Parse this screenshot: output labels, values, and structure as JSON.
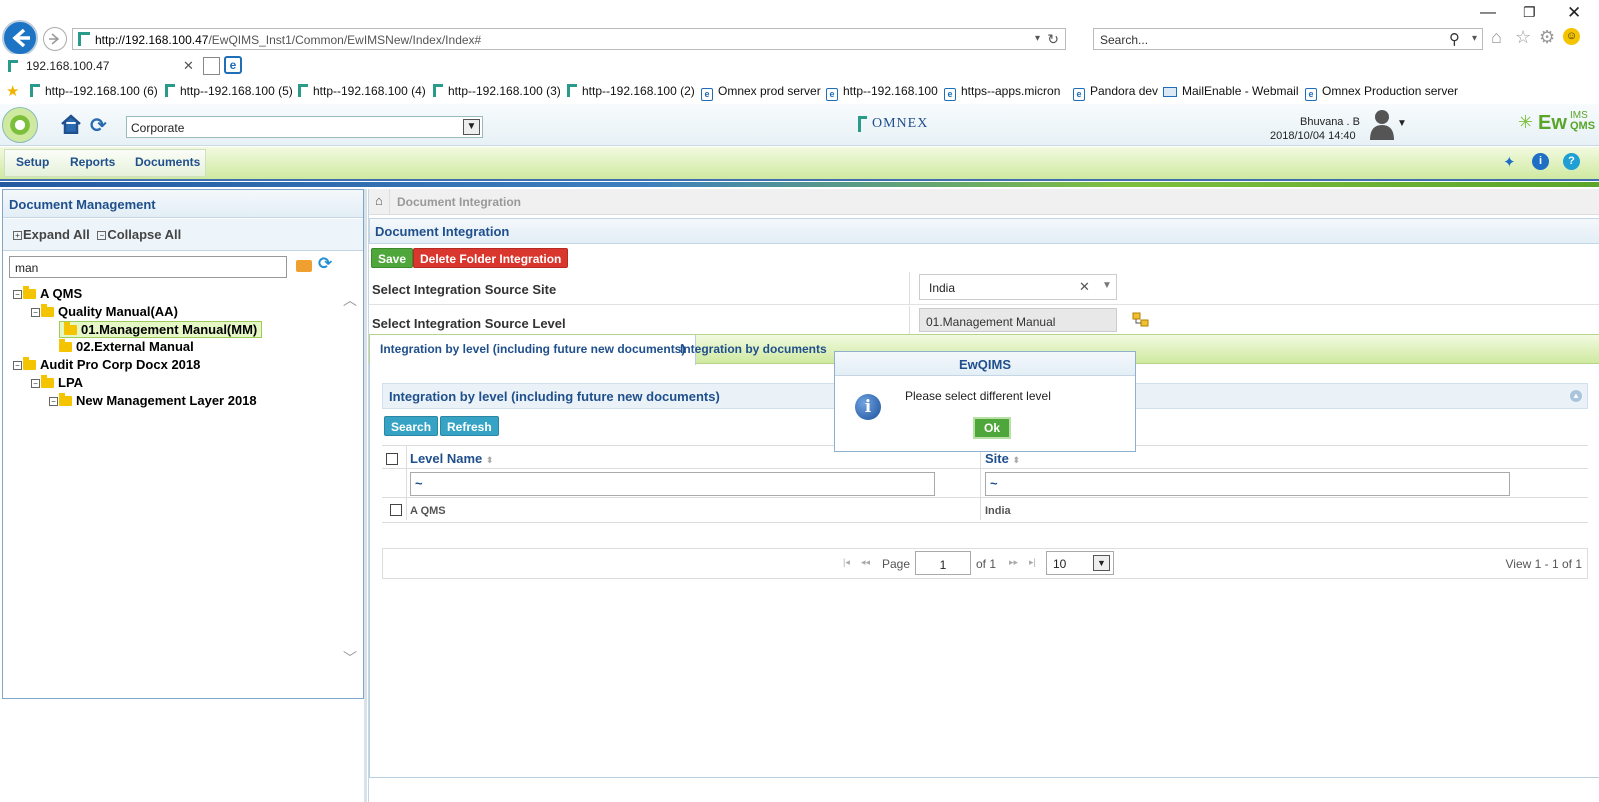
{
  "browser": {
    "url_host": "http://192.168.100.47",
    "url_path": "/EwQIMS_Inst1/Common/EwIMSNew/Index/Index#",
    "search_placeholder": "Search...",
    "tab_title": "192.168.100.47",
    "favorites": [
      {
        "label": "http--192.168.100 (6)",
        "icon": "ewqims-icon"
      },
      {
        "label": "http--192.168.100 (5)",
        "icon": "ewqims-icon"
      },
      {
        "label": "http--192.168.100 (4)",
        "icon": "ewqims-icon"
      },
      {
        "label": "http--192.168.100 (3)",
        "icon": "ewqims-icon"
      },
      {
        "label": "http--192.168.100 (2)",
        "icon": "ewqims-icon"
      },
      {
        "label": "Omnex prod server",
        "icon": "ie-icon"
      },
      {
        "label": "http--192.168.100",
        "icon": "ie-icon"
      },
      {
        "label": "https--apps.micron",
        "icon": "ie-icon"
      },
      {
        "label": "Pandora dev",
        "icon": "ie-icon"
      },
      {
        "label": "MailEnable - Webmail",
        "icon": "mail-icon"
      },
      {
        "label": "Omnex Production server",
        "icon": "ie-icon"
      }
    ]
  },
  "header": {
    "site_select": "Corporate",
    "center_logo": "OMNEX",
    "user_name": "Bhuvana . B",
    "datetime": "2018/10/04 14:40",
    "brand": "EwQIMS",
    "brand_sup": "IMS"
  },
  "menu": {
    "items": [
      "Setup",
      "Reports",
      "Documents"
    ]
  },
  "left": {
    "title": "Document Management",
    "expand_all": "Expand All",
    "collapse_all": "Collapse All",
    "search_value": "man",
    "tree": [
      {
        "label": "A QMS",
        "level": 0
      },
      {
        "label": "Quality Manual(AA)",
        "level": 1
      },
      {
        "label": "01.Management Manual(MM)",
        "level": 2,
        "selected": true
      },
      {
        "label": "02.External Manual",
        "level": 2
      },
      {
        "label": "Audit Pro Corp Docx 2018",
        "level": 0
      },
      {
        "label": "LPA",
        "level": 1
      },
      {
        "label": "New Management Layer 2018",
        "level": 2
      }
    ]
  },
  "main": {
    "breadcrumb": "Document Integration",
    "section_title": "Document Integration",
    "save_label": "Save",
    "delete_label": "Delete Folder Integration",
    "site_label": "Select Integration Source Site",
    "site_value": "India",
    "level_label": "Select Integration Source Level",
    "level_value": "01.Management Manual",
    "tabs": [
      "Integration by level (including future new documents)",
      "Integration by documents"
    ],
    "inner_title": "Integration by level (including future new documents)",
    "search_label": "Search",
    "refresh_label": "Refresh",
    "columns": [
      "Level Name",
      "Site"
    ],
    "filter_value": "~",
    "rows": [
      {
        "level": "A QMS",
        "site": "India"
      }
    ],
    "pager": {
      "page_label": "Page",
      "page_value": "1",
      "of_label": "of 1",
      "page_size": "10",
      "view_text": "View 1 - 1 of 1"
    }
  },
  "dialog": {
    "title": "EwQIMS",
    "message": "Please select different level",
    "ok_label": "Ok"
  },
  "colors": {
    "accent_blue": "#1f4f8c",
    "save_green": "#4fa63a",
    "delete_red": "#d9362e",
    "button_teal": "#36a3c4"
  }
}
